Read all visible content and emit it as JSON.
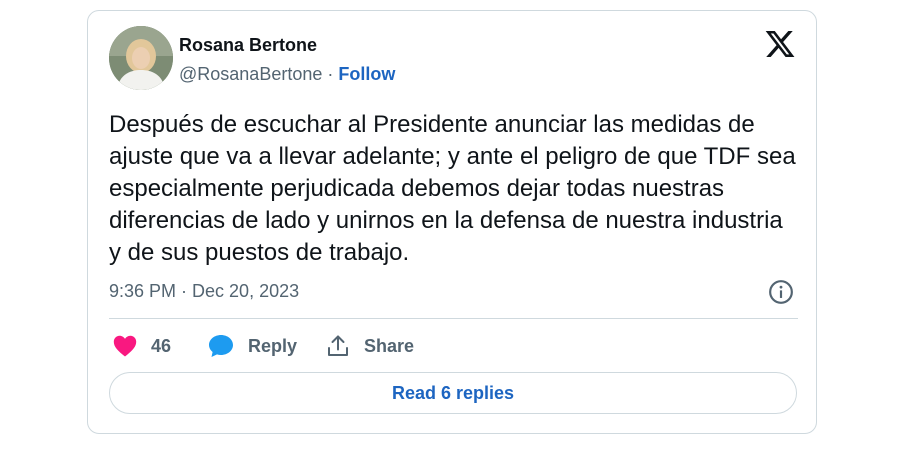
{
  "author": {
    "name": "Rosana Bertone",
    "handle": "@RosanaBertone",
    "separator": " · ",
    "follow_label": "Follow"
  },
  "tweet": {
    "text": "Después de escuchar al Presidente anunciar las medidas de ajuste que va a llevar adelante; y ante el peligro de que TDF sea especialmente perjudicada debemos dejar todas nuestras diferencias de lado y unirnos en la defensa de nuestra industria y de sus puestos de trabajo.",
    "timestamp": "9:36 PM · Dec 20, 2023"
  },
  "actions": {
    "like_count": "46",
    "reply_label": "Reply",
    "share_label": "Share"
  },
  "read_replies_label": "Read 6 replies",
  "colors": {
    "like": "#f91880",
    "reply": "#1d9bf0",
    "link": "#1d65c1",
    "muted": "#536471",
    "border": "#cfd9de"
  },
  "icons": [
    "x-logo-icon",
    "info-icon",
    "heart-icon",
    "reply-bubble-icon",
    "share-icon"
  ]
}
